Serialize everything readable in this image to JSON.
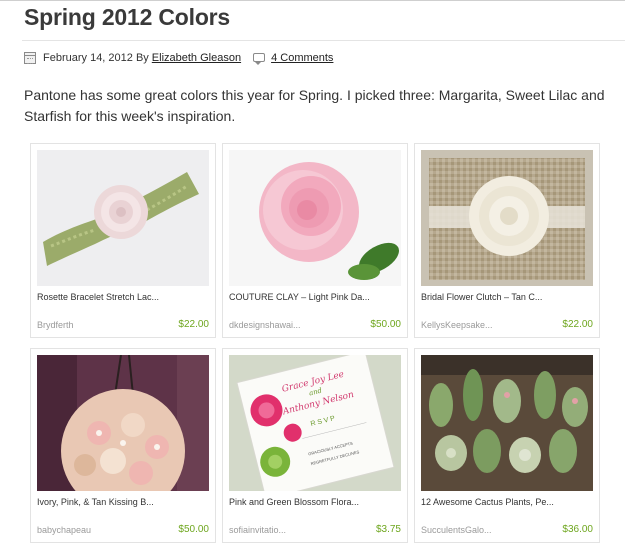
{
  "post": {
    "title": "Spring 2012 Colors",
    "date": "February 14, 2012 By",
    "author": "Elizabeth Gleason",
    "comments": "4 Comments",
    "intro": "Pantone has some great colors this year for Spring. I picked three: Margarita, Sweet Lilac and Starfish for this week's inspiration."
  },
  "items": [
    {
      "title": "Rosette Bracelet Stretch Lac...",
      "shop": "Brydferth",
      "price": "$22.00",
      "image": "rosette-bracelet-image"
    },
    {
      "title": "COUTURE CLAY – Light Pink Da...",
      "shop": "dkdesignshawai...",
      "price": "$50.00",
      "image": "pink-rose-image"
    },
    {
      "title": "Bridal Flower Clutch – Tan C...",
      "shop": "KellysKeepsake...",
      "price": "$22.00",
      "image": "flower-clutch-image"
    },
    {
      "title": "Ivory, Pink, & Tan Kissing B...",
      "shop": "babychapeau",
      "price": "$50.00",
      "image": "kissing-ball-image"
    },
    {
      "title": "Pink and Green Blossom Flora...",
      "shop": "sofiainvitatio...",
      "price": "$3.75",
      "image": "blossom-invitation-image"
    },
    {
      "title": "12 Awesome Cactus Plants, Pe...",
      "shop": "SucculentsGalo...",
      "price": "$36.00",
      "image": "cactus-plants-image"
    }
  ],
  "invitation_text": {
    "names": "Grace Joy Lee",
    "and": "and",
    "names2": "Anthony Nelson",
    "rsvp": "R S V P",
    "accepts": "GRACIOUSLY ACCEPTS",
    "declines": "REGRETFULLY DECLINES"
  },
  "colors": {
    "title": "#3a3a3a",
    "price": "#6ea61e",
    "shop": "#9a9a9a",
    "border": "#e3e3e3"
  }
}
